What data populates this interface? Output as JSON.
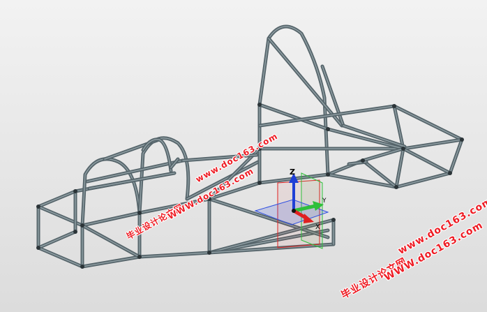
{
  "viewport": {
    "background": "#e6e6e6",
    "frame_color": "#55646a",
    "frame_highlight": "#8f9ea3"
  },
  "triad": {
    "axes": [
      {
        "label": "Z",
        "color": "#1f3fd6"
      },
      {
        "label": "Y",
        "color": "#2fbf3a"
      },
      {
        "label": "X",
        "color": "#e02020"
      }
    ],
    "planes": {
      "front": "#e02020",
      "top": "#3050e0",
      "right": "#2fbf3a"
    }
  },
  "watermarks": [
    {
      "id": "wm1_domain",
      "text": "www.doc163.com"
    },
    {
      "id": "wm1_cn",
      "text": "毕业设计论文网"
    },
    {
      "id": "wm1_url",
      "text": "WWW.doc163.com"
    },
    {
      "id": "wm2_domain",
      "text": "www.doc163.com"
    },
    {
      "id": "wm2_cn",
      "text": "毕业设计论文网"
    },
    {
      "id": "wm2_url",
      "text": "WWW.doc163.com"
    }
  ]
}
